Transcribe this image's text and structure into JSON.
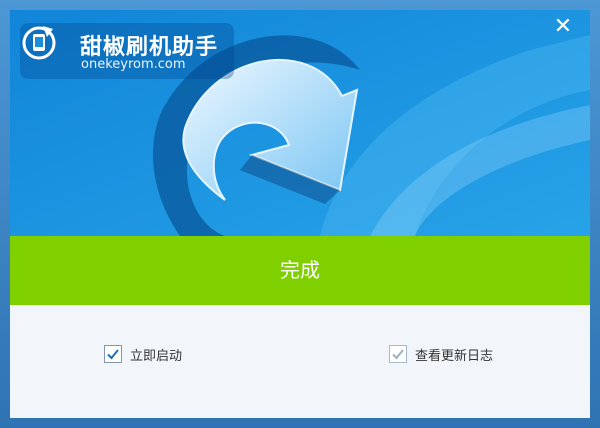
{
  "app": {
    "title": "甜椒刷机助手",
    "url": "onekeyrom.com"
  },
  "window": {
    "close_label": "✕"
  },
  "status": {
    "done_label": "完成"
  },
  "options": [
    {
      "label": "立即启动",
      "checked": true
    },
    {
      "label": "查看更新日志",
      "checked": true
    }
  ],
  "colors": {
    "hero_blue": "#1a8fd9",
    "done_green": "#80d000",
    "panel_bg": "#f2f5f9"
  },
  "icons": {
    "logo": "phone-with-refresh-arrow-icon",
    "close": "close-icon",
    "check": "checkmark-icon"
  }
}
